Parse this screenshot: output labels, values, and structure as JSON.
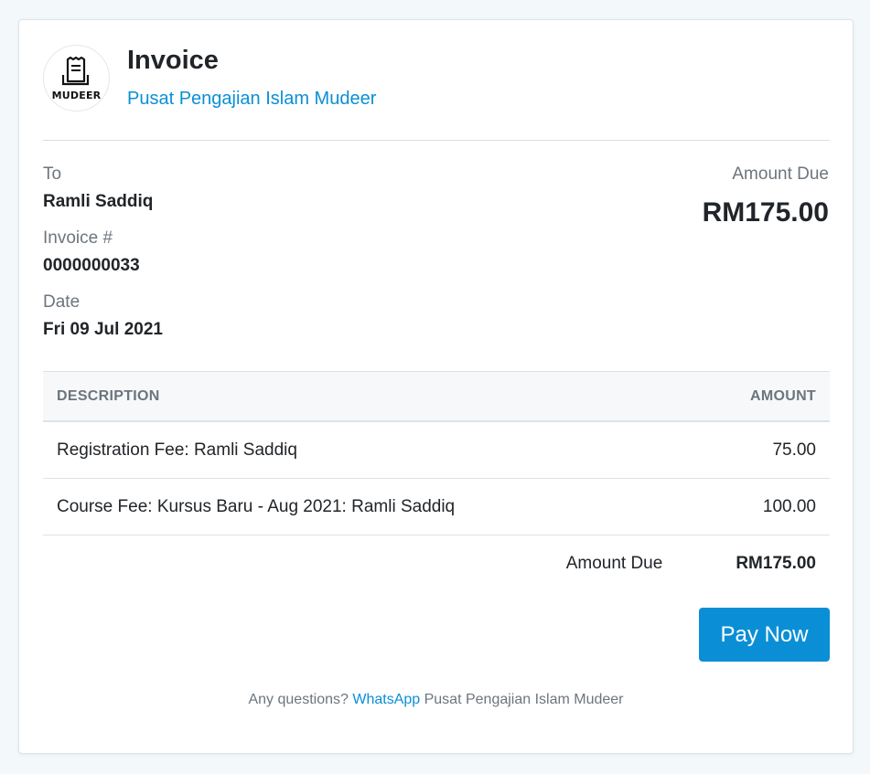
{
  "header": {
    "logo_text": "MUDEER",
    "title": "Invoice",
    "organization": "Pusat Pengajian Islam Mudeer"
  },
  "details": {
    "to_label": "To",
    "to_value": "Ramli Saddiq",
    "invoice_label": "Invoice #",
    "invoice_value": "0000000033",
    "date_label": "Date",
    "date_value": "Fri 09 Jul 2021"
  },
  "amount_due": {
    "label": "Amount Due",
    "value": "RM175.00"
  },
  "table": {
    "headers": {
      "description": "DESCRIPTION",
      "amount": "AMOUNT"
    },
    "rows": [
      {
        "description": "Registration Fee: Ramli Saddiq",
        "amount": "75.00"
      },
      {
        "description": "Course Fee: Kursus Baru - Aug 2021: Ramli Saddiq",
        "amount": "100.00"
      }
    ],
    "total": {
      "label": "Amount Due",
      "value": "RM175.00"
    }
  },
  "actions": {
    "pay_label": "Pay Now"
  },
  "footer": {
    "prefix": "Any questions?",
    "link_text": "WhatsApp",
    "suffix": "Pusat Pengajian Islam Mudeer"
  },
  "colors": {
    "accent": "#0a8fd6",
    "muted": "#6c757d",
    "text": "#212529",
    "background": "#f3f8fb"
  }
}
